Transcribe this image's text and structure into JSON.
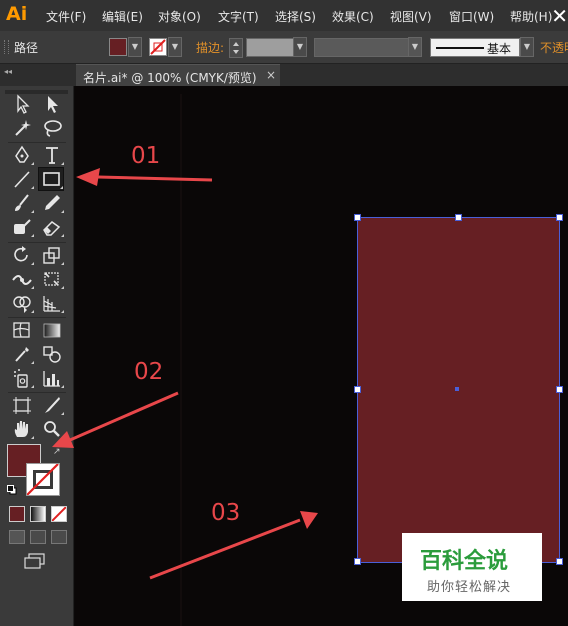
{
  "app": {
    "logo": "Ai"
  },
  "menubar": {
    "items": [
      "文件(F)",
      "编辑(E)",
      "对象(O)",
      "文字(T)",
      "选择(S)",
      "效果(C)",
      "视图(V)",
      "窗口(W)",
      "帮助(H)"
    ]
  },
  "control_bar": {
    "selection_label": "路径",
    "fill_color": "#661f23",
    "stroke_label": "描边:",
    "profile_label": "基本",
    "opacity_label": "不透明"
  },
  "document": {
    "tab_title": "名片.ai* @ 100% (CMYK/预览)",
    "close_glyph": "×"
  },
  "toolbox": {
    "fill_color": "#661f23",
    "stroke": "none"
  },
  "canvas": {
    "rectangle_fill": "#661f23",
    "selection_color": "#4a5fd8"
  },
  "annotations": {
    "step1": "01",
    "step2": "02",
    "step3": "03",
    "arrow_color": "#e8474a"
  },
  "watermark": {
    "title": "百科全说",
    "subtitle": "助你轻松解决"
  }
}
